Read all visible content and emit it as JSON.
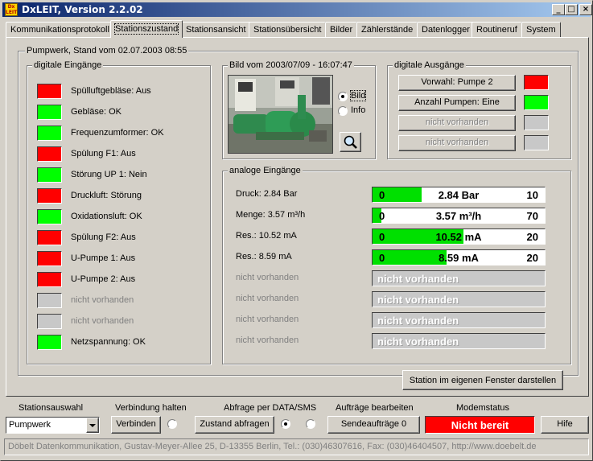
{
  "window": {
    "title": "DxLEIT, Version 2.2.02",
    "icon": "dxleit-app-icon"
  },
  "window_controls": {
    "minimize": "_",
    "maximize": "□",
    "close": "×"
  },
  "tabs": [
    "Kommunikationsprotokoll",
    "Stationszustand",
    "Stationsansicht",
    "Stationsübersicht",
    "Bilder",
    "Zählerstände",
    "Datenlogger",
    "Routineruf",
    "System"
  ],
  "active_tab": "Stationszustand",
  "panel": {
    "header": "Pumpwerk, Stand vom 02.07.2003   08:55",
    "digital_inputs": {
      "title": "digitale Eingänge",
      "items": [
        {
          "label": "Spülluftgebläse: Aus",
          "color": "#ff0000"
        },
        {
          "label": "Gebläse: OK",
          "color": "#00ff00"
        },
        {
          "label": "Frequenzumformer: OK",
          "color": "#00ff00"
        },
        {
          "label": "Spülung F1: Aus",
          "color": "#ff0000"
        },
        {
          "label": "Störung UP 1: Nein",
          "color": "#00ff00"
        },
        {
          "label": "Druckluft: Störung",
          "color": "#ff0000"
        },
        {
          "label": "Oxidationsluft: OK",
          "color": "#00ff00"
        },
        {
          "label": "Spülung F2: Aus",
          "color": "#ff0000"
        },
        {
          "label": "U-Pumpe 1: Aus",
          "color": "#ff0000"
        },
        {
          "label": "U-Pumpe 2: Aus",
          "color": "#ff0000"
        },
        {
          "label": "nicht vorhanden",
          "color": "#c8c8c8"
        },
        {
          "label": "nicht vorhanden",
          "color": "#c8c8c8"
        },
        {
          "label": "Netzspannung: OK",
          "color": "#00ff00"
        }
      ]
    },
    "image": {
      "title": "Bild vom 2003/07/09 - 16:07:47",
      "radio_bild": "Bild",
      "radio_info": "Info",
      "selected": "Bild",
      "zoom_icon": "magnifier-icon"
    },
    "digital_outputs": {
      "title": "digitale Ausgänge",
      "items": [
        {
          "label": "Vorwahl: Pumpe 2",
          "color": "#ff0000",
          "enabled": true
        },
        {
          "label": "Anzahl Pumpen: Eine",
          "color": "#00ff00",
          "enabled": true
        },
        {
          "label": "nicht vorhanden",
          "color": "#c8c8c8",
          "enabled": false
        },
        {
          "label": "nicht vorhanden",
          "color": "#c8c8c8",
          "enabled": false
        }
      ]
    },
    "analog_inputs": {
      "title": "analoge Eingänge",
      "items": [
        {
          "label": "Druck: 2.84 Bar",
          "min": "0",
          "max": "10",
          "display": "2.84 Bar",
          "fraction": 0.284
        },
        {
          "label": "Menge: 3.57 m³/h",
          "min": "0",
          "max": "70",
          "display": "3.57 m³/h",
          "fraction": 0.051
        },
        {
          "label": "Res.: 10.52 mA",
          "min": "0",
          "max": "20",
          "display": "10.52 mA",
          "fraction": 0.526
        },
        {
          "label": "Res.: 8.59 mA",
          "min": "0",
          "max": "20",
          "display": "8.59 mA",
          "fraction": 0.4295
        },
        {
          "label": "nicht vorhanden",
          "na": "nicht vorhanden"
        },
        {
          "label": "nicht vorhanden",
          "na": "nicht vorhanden"
        },
        {
          "label": "nicht vorhanden",
          "na": "nicht vorhanden"
        },
        {
          "label": "nicht vorhanden",
          "na": "nicht vorhanden"
        }
      ]
    },
    "own_window_button": "Station im eigenen Fenster darstellen"
  },
  "bottom": {
    "station_label": "Stationsauswahl",
    "station_value": "Pumpwerk",
    "connection_label": "Verbindung  halten",
    "connect_button": "Verbinden",
    "query_label": "Abfrage per   DATA/SMS",
    "query_button": "Zustand abfragen",
    "jobs_label": "Aufträge bearbeiten",
    "send_button": "Sendeaufträge 0",
    "modem_label": "Modemstatus",
    "modem_status": "Nicht bereit",
    "modem_color": "#ff0000",
    "help_button": "Hife"
  },
  "statusbar": "Döbelt Datenkommunikation, Gustav-Meyer-Allee 25, D-13355 Berlin, Tel.: (030)46307616, Fax: (030)46404507, http://www.doebelt.de"
}
